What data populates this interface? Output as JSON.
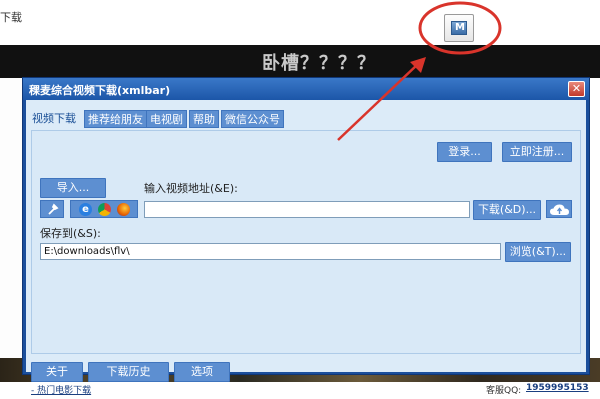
{
  "background": {
    "top_cut_text": "下载",
    "band_title": "卧槽？？？？"
  },
  "window": {
    "title": "稞麦综合视频下载(xmlbar)",
    "close_label": "✕"
  },
  "tabs": [
    {
      "label": "视频下载",
      "active": true
    },
    {
      "label": "推荐给朋友",
      "active": false
    },
    {
      "label": "电视剧",
      "active": false
    },
    {
      "label": "帮助",
      "active": false
    },
    {
      "label": "微信公众号",
      "active": false
    }
  ],
  "auth": {
    "login_label": "登录...",
    "register_label": "立即注册..."
  },
  "video": {
    "import_label": "导入...",
    "url_label": "输入视频地址(&E):",
    "url_value": "",
    "download_label": "下载(&D)..."
  },
  "save": {
    "label": "保存到(&S):",
    "path_value": "E:\\downloads\\flv\\",
    "browse_label": "浏览(&T)..."
  },
  "footer": {
    "about_label": "关于(&A)...",
    "history_label": "下载历史(&H)...",
    "options_label": "选项(&O)...",
    "hot_link": "- 热门电影下载",
    "qq_label": "客服QQ:",
    "qq_number": "1959995153"
  },
  "icons": {
    "tray": "xmlbar-app-icon",
    "tool": "wrench-icon",
    "ie": "internet-explorer-icon",
    "chrome": "chrome-icon",
    "firefox": "firefox-icon",
    "cloud": "cloud-upload-icon"
  },
  "colors": {
    "title_bar": "#1c56a8",
    "button_fill": "#5d8fd1",
    "client_bg": "#dcebf8",
    "annotation_red": "#d9342b"
  }
}
